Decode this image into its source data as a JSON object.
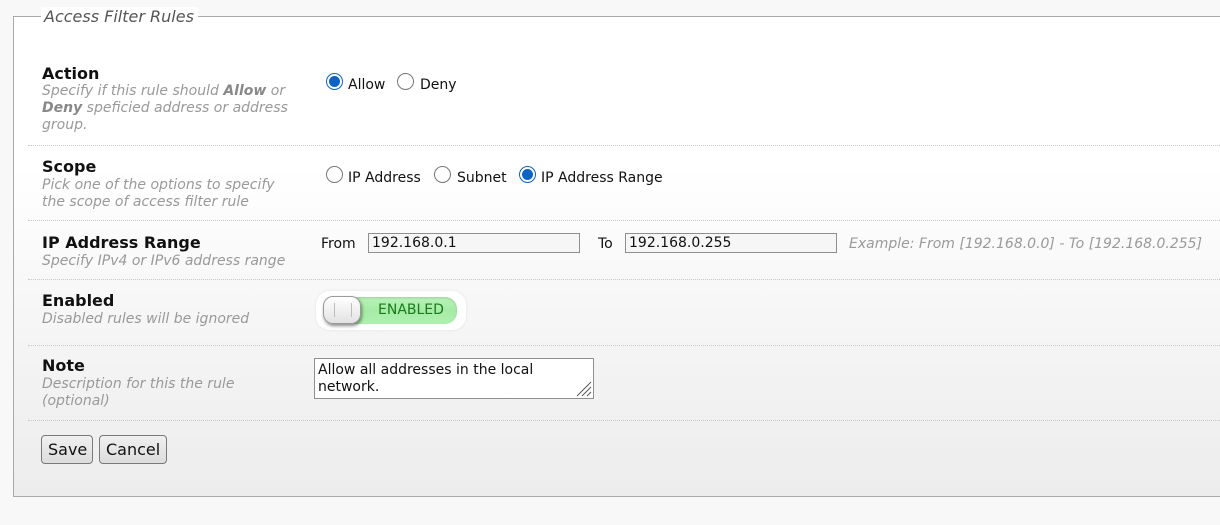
{
  "form": {
    "legend": "Access Filter Rules",
    "action": {
      "title": "Action",
      "desc_part1": "Specify if this rule should ",
      "desc_allow": "Allow",
      "desc_part2": " or ",
      "desc_deny": "Deny",
      "desc_part3": " speficied address or address group.",
      "options": [
        {
          "label": "Allow",
          "checked": true
        },
        {
          "label": "Deny",
          "checked": false
        }
      ]
    },
    "scope": {
      "title": "Scope",
      "desc": "Pick one of the options to specify the scope of access filter rule",
      "options": [
        {
          "label": "IP Address",
          "checked": false
        },
        {
          "label": "Subnet",
          "checked": false
        },
        {
          "label": "IP Address Range",
          "checked": true
        }
      ]
    },
    "range": {
      "title": "IP Address Range",
      "desc": "Specify IPv4 or IPv6 address range",
      "from_label": "From",
      "from_value": "192.168.0.1",
      "to_label": "To",
      "to_value": "192.168.0.255",
      "hint": "Example: From [192.168.0.0] - To [192.168.0.255]"
    },
    "enabled": {
      "title": "Enabled",
      "desc": "Disabled rules will be ignored",
      "toggle_label": "ENABLED",
      "state": true
    },
    "note": {
      "title": "Note",
      "desc": "Description for this the rule (optional)",
      "value": "Allow all addresses in the local network."
    },
    "buttons": {
      "save": "Save",
      "cancel": "Cancel"
    }
  }
}
